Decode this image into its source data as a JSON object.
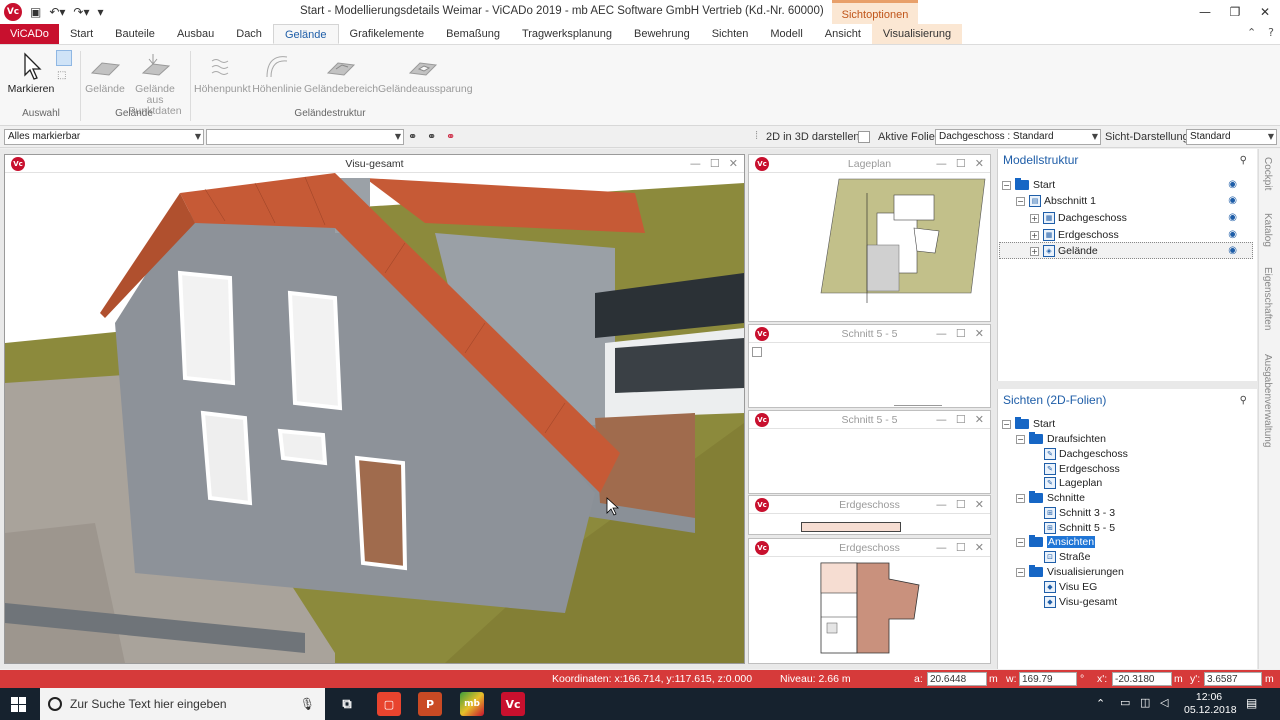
{
  "window": {
    "title": "Start - Modellierungsdetails Weimar - ViCADo 2019 - mb AEC Software GmbH Vertrieb (Kd.-Nr. 60000)",
    "context_tab": "Sichtoptionen",
    "app_logo": "Vc"
  },
  "ribbon_tabs": [
    "ViCADo",
    "Start",
    "Bauteile",
    "Ausbau",
    "Dach",
    "Gelände",
    "Grafikelemente",
    "Bemaßung",
    "Tragwerksplanung",
    "Bewehrung",
    "Sichten",
    "Modell",
    "Ansicht",
    "Visualisierung"
  ],
  "ribbon": {
    "markieren": "Markieren",
    "gelaende": "Gelände",
    "gelaende_aus": "Gelände aus",
    "punktdaten": "Punktdaten",
    "hoehenpunkt": "Höhenpunkt",
    "hoehenlinie": "Höhenlinie",
    "gelaendebereich": "Geländebereich",
    "gelaendeaussparung": "Geländeaussparung",
    "group_auswahl": "Auswahl",
    "group_gelaende": "Gelände",
    "group_gelaendestruktur": "Geländestruktur"
  },
  "options": {
    "selection_filter": "Alles markierbar",
    "second_filter": "",
    "label_2d3d": "2D in 3D darstellen:",
    "label_folie": "Aktive Folie:",
    "folie_value": "Dachgeschoss : Standard",
    "label_sicht": "Sicht-Darstellung:",
    "sicht_value": "Standard"
  },
  "views": {
    "main": "Visu-gesamt",
    "lageplan": "Lageplan",
    "schnitt1": "Schnitt 5 - 5",
    "schnitt2": "Schnitt 5 - 5",
    "erdgeschoss1": "Erdgeschoss",
    "erdgeschoss2": "Erdgeschoss"
  },
  "modellstruktur": {
    "title": "Modellstruktur",
    "start": "Start",
    "abschnitt": "Abschnitt 1",
    "dachgeschoss": "Dachgeschoss",
    "erdgeschoss": "Erdgeschoss",
    "gelaende": "Gelände"
  },
  "sichten": {
    "title": "Sichten (2D-Folien)",
    "start": "Start",
    "draufsichten": "Draufsichten",
    "dachgeschoss": "Dachgeschoss",
    "erdgeschoss": "Erdgeschoss",
    "lageplan": "Lageplan",
    "schnitte": "Schnitte",
    "schnitt33": "Schnitt 3 - 3",
    "schnitt55": "Schnitt 5 - 5",
    "ansichten": "Ansichten",
    "strasse": "Straße",
    "visualisierungen": "Visualisierungen",
    "visu_eg": "Visu EG",
    "visu_gesamt": "Visu-gesamt"
  },
  "side_tabs": [
    "Cockpit",
    "Katalog",
    "Eigenschaften",
    "Ausgabenverwaltung"
  ],
  "status": {
    "coords": "Koordinaten: x:166.714, y:117.615, z:0.000",
    "niveau": "Niveau: 2.66 m",
    "a_label": "a:",
    "a_value": "20.6448",
    "a_unit": "m",
    "w_label": "w:",
    "w_value": "169.79",
    "w_unit": "°",
    "x_label": "x':",
    "x_value": "-20.3180",
    "x_unit": "m",
    "y_label": "y':",
    "y_value": "3.6587",
    "y_unit": "m"
  },
  "taskbar": {
    "search_placeholder": "Zur Suche Text hier eingeben",
    "time": "12:06",
    "date": "05.12.2018"
  },
  "colors": {
    "brand_red": "#c8102e",
    "accent_blue": "#1f5ea8",
    "roof": "#c65a36",
    "wall": "#8d9299",
    "grass": "#8c8a3c",
    "paving": "#a9a39b"
  }
}
